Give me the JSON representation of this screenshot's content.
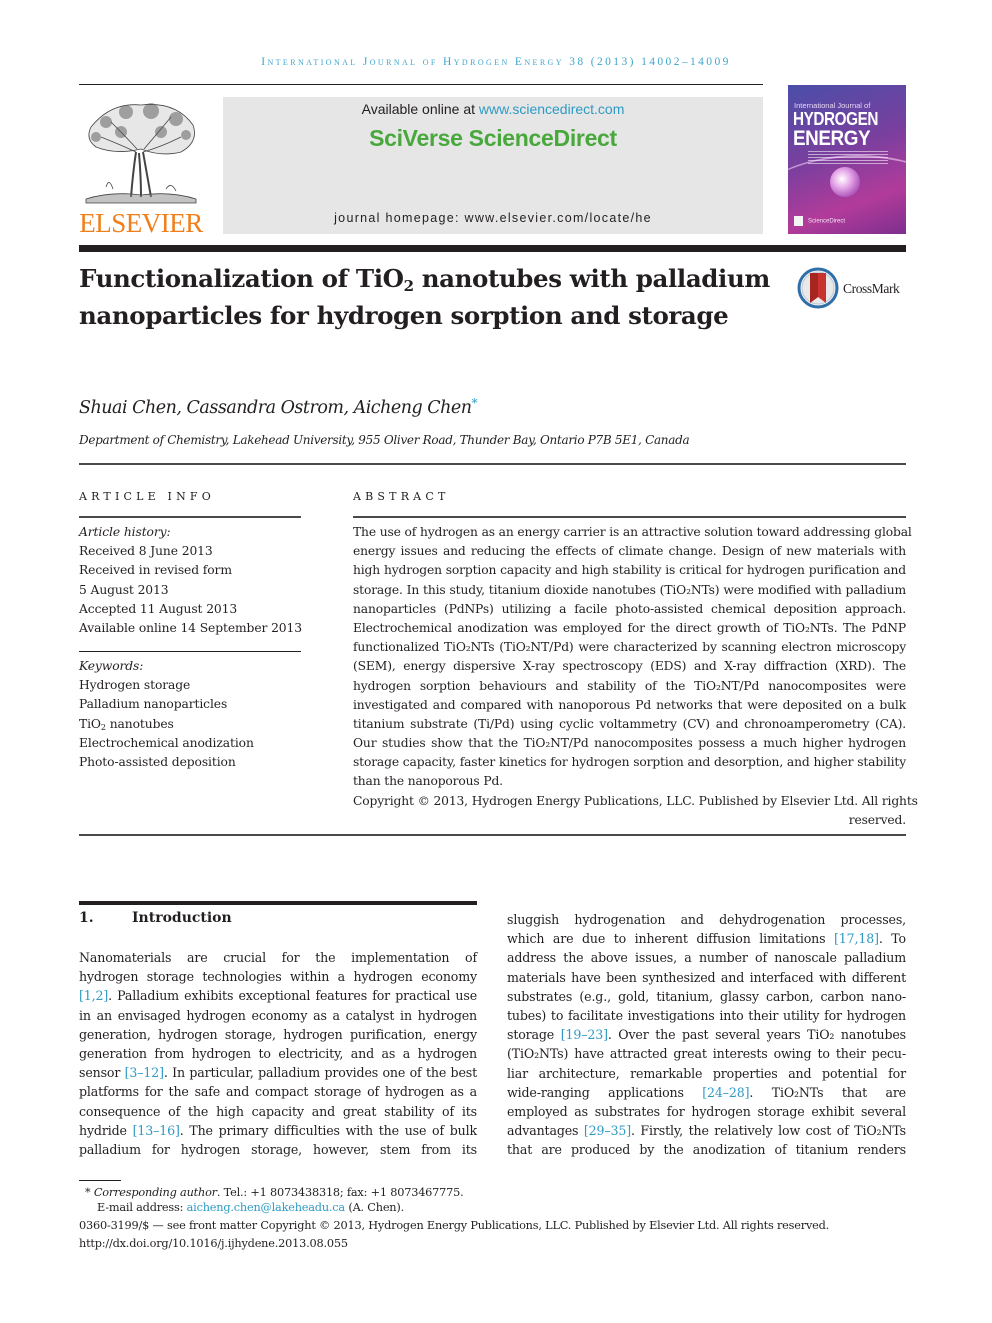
{
  "running_head": "International Journal of Hydrogen Energy 38 (2013) 14002–14009",
  "publisher": {
    "logo_text": "ELSEVIER",
    "logo_icon": "tree-icon",
    "logo_color": "#f07f1a"
  },
  "sciencedirect": {
    "available_prefix": "Available online at ",
    "available_link": "www.sciencedirect.com",
    "brand": "SciVerse ScienceDirect",
    "brand_color": "#48a83c",
    "homepage_label": "journal homepage: ",
    "homepage_url": "www.elsevier.com/locate/he",
    "box_color": "#e6e6e6"
  },
  "journal_cover": {
    "pre_title": "International Journal of",
    "title_line1": "HYDROGEN",
    "title_line2": "ENERGY",
    "footer": "ScienceDirect"
  },
  "article": {
    "title_part1": "Functionalization of TiO",
    "title_sub": "2",
    "title_part2": " nanotubes with palladium nanoparticles for hydrogen sorption and storage",
    "crossmark_label": "CrossMark",
    "authors": "Shuai Chen, Cassandra Ostrom, Aicheng Chen",
    "corresponding_mark": "*",
    "affiliation": "Department of Chemistry, Lakehead University, 955 Oliver Road, Thunder Bay, Ontario P7B 5E1, Canada"
  },
  "article_info": {
    "heading": "ARTICLE INFO",
    "history_label": "Article history:",
    "history": [
      "Received 8 June 2013",
      "Received in revised form",
      "5 August 2013",
      "Accepted 11 August 2013",
      "Available online 14 September 2013"
    ],
    "keywords_label": "Keywords:",
    "keywords": [
      {
        "text": "Hydrogen storage"
      },
      {
        "text": "Palladium nanoparticles"
      },
      {
        "pre": "TiO",
        "sub": "2",
        "post": " nanotubes"
      },
      {
        "text": "Electrochemical anodization"
      },
      {
        "text": "Photo-assisted deposition"
      }
    ]
  },
  "abstract": {
    "heading": "ABSTRACT",
    "lines": [
      "The use of hydrogen as an energy carrier is an attractive solution toward addressing global",
      "energy issues and reducing the effects of climate change. Design of new materials with",
      "high hydrogen sorption capacity and high stability is critical for hydrogen purification and",
      "storage. In this study, titanium dioxide nanotubes (TiO₂NTs) were modified with palladium",
      "nanoparticles (PdNPs) utilizing a facile photo-assisted chemical deposition approach.",
      "Electrochemical anodization was employed for the direct growth of TiO₂NTs. The PdNP",
      "functionalized TiO₂NTs (TiO₂NT/Pd) were characterized by scanning electron microscopy",
      "(SEM), energy dispersive X-ray spectroscopy (EDS) and X-ray diffraction (XRD). The",
      "hydrogen sorption behaviours and stability of the TiO₂NT/Pd nanocomposites were",
      "investigated and compared with nanoporous Pd networks that were deposited on a bulk",
      "titanium substrate (Ti/Pd) using cyclic voltammetry (CV) and chronoamperometry (CA).",
      "Our studies show that the TiO₂NT/Pd nanocomposites possess a much higher hydrogen",
      "storage capacity, faster kinetics for hydrogen sorption and desorption, and higher stability",
      "than the nanoporous Pd."
    ],
    "copyright_line1": "Copyright © 2013, Hydrogen Energy Publications, LLC. Published by Elsevier Ltd. All rights",
    "copyright_line2": "reserved."
  },
  "introduction": {
    "number": "1.",
    "heading": "Introduction",
    "left_lines": [
      {
        "t": "Nanomaterials are crucial for the implementation of"
      },
      {
        "t": "hydrogen storage technologies within a hydrogen economy"
      },
      {
        "ref": "[1,2]",
        "t": ". Palladium exhibits exceptional features for practical use"
      },
      {
        "t": "in an envisaged hydrogen economy as a catalyst in hydrogen"
      },
      {
        "t": "generation, hydrogen storage, hydrogen purification, energy"
      },
      {
        "t": "generation from hydrogen to electricity, and as a hydrogen"
      },
      {
        "t": "sensor ",
        "ref": "[3–12]",
        "t2": ". In particular, palladium provides one of the best"
      },
      {
        "t": "platforms for the safe and compact storage of hydrogen as a"
      },
      {
        "t": "consequence of the high capacity and great stability of its"
      },
      {
        "t": "hydride ",
        "ref": "[13–16]",
        "t2": ". The primary difficulties with the use of bulk"
      },
      {
        "t": "palladium for hydrogen storage, however, stem from its"
      }
    ],
    "right_lines": [
      {
        "t": "sluggish hydrogenation and dehydrogenation processes,"
      },
      {
        "t": "which are due to inherent diffusion limitations ",
        "ref": "[17,18]",
        "t2": ". To"
      },
      {
        "t": "address the above issues, a number of nanoscale palladium"
      },
      {
        "t": "materials have been synthesized and interfaced with different"
      },
      {
        "t": "substrates (e.g., gold, titanium, glassy carbon, carbon nano-"
      },
      {
        "t": "tubes) to facilitate investigations into their utility for hydrogen"
      },
      {
        "t": "storage ",
        "ref": "[19–23]",
        "t2": ". Over the past several years TiO₂ nanotubes"
      },
      {
        "t": "(TiO₂NTs) have attracted great interests owing to their pecu-"
      },
      {
        "t": "liar architecture, remarkable properties and potential for"
      },
      {
        "t": "wide-ranging applications ",
        "ref": "[24–28]",
        "t2": ". TiO₂NTs that are"
      },
      {
        "t": "employed as substrates for hydrogen storage exhibit several"
      },
      {
        "t": "advantages ",
        "ref": "[29–35]",
        "t2": ". Firstly, the relatively low cost of TiO₂NTs"
      },
      {
        "t": "that are produced by the anodization of titanium renders"
      }
    ]
  },
  "footnotes": {
    "mark": "*",
    "corresponding_label": "Corresponding author",
    "contact": ". Tel.: +1 8073438318; fax: +1 8073467775.",
    "email_label": "E-mail address: ",
    "email": "aicheng.chen@lakeheadu.ca",
    "email_suffix": " (A. Chen).",
    "issn_line": "0360-3199/$ — see front matter Copyright © 2013, Hydrogen Energy Publications, LLC. Published by Elsevier Ltd. All rights reserved.",
    "doi": "http://dx.doi.org/10.1016/j.ijhydene.2013.08.055"
  },
  "colors": {
    "link": "#2e9ac4",
    "running_head": "#3fa6cb",
    "text": "#231f20"
  }
}
